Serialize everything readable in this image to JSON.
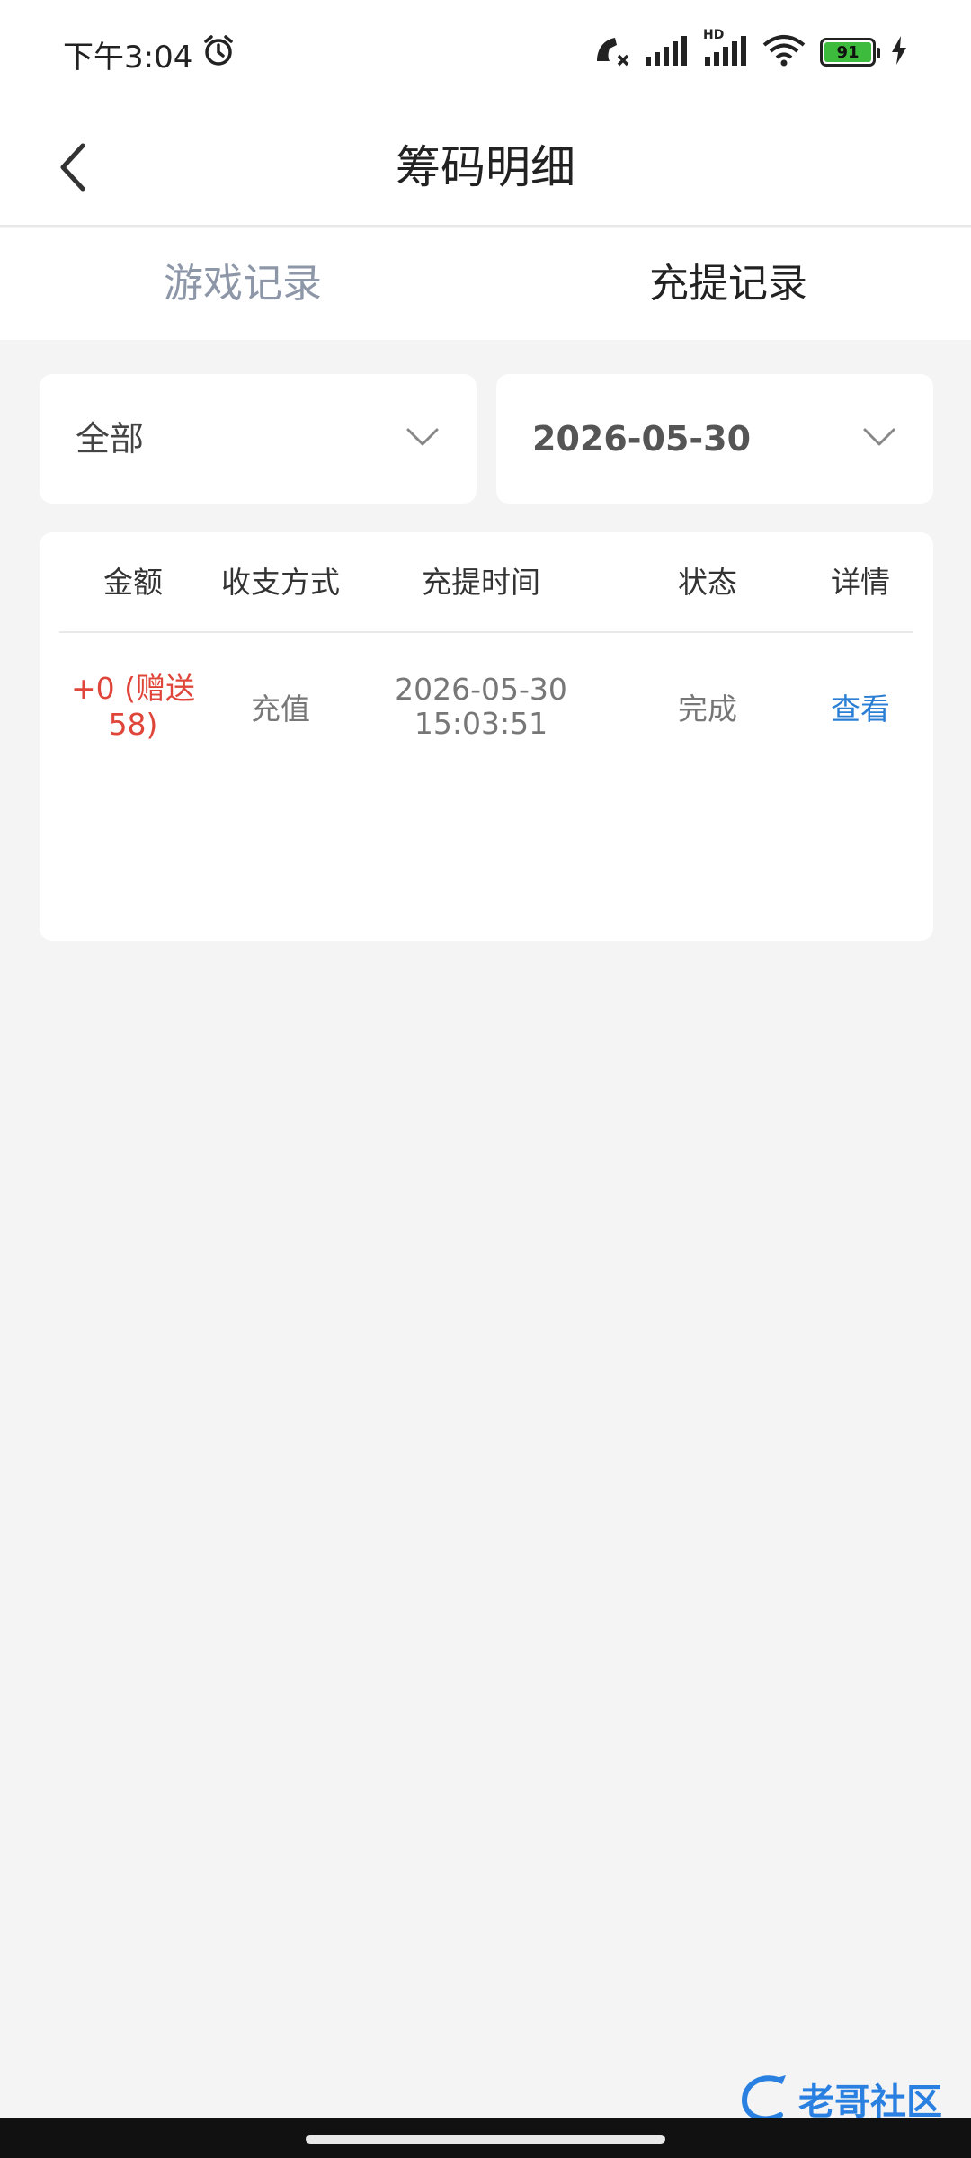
{
  "status_bar": {
    "time": "下午3:04",
    "battery": "91",
    "network_label": "HD"
  },
  "nav": {
    "title": "筹码明细"
  },
  "tabs": [
    {
      "label": "游戏记录",
      "active": false
    },
    {
      "label": "充提记录",
      "active": true
    }
  ],
  "filters": {
    "type_value": "全部",
    "date_value": "2026-05-30"
  },
  "table": {
    "headers": [
      "金额",
      "收支方式",
      "充提时间",
      "状态",
      "详情"
    ],
    "rows": [
      {
        "amount": "+0 (赠送58)",
        "method": "充值",
        "date": "2026-05-30",
        "time": "15:03:51",
        "status": "完成",
        "action": "查看"
      }
    ]
  },
  "watermark": {
    "text": "老哥社区"
  },
  "colors": {
    "accent_red": "#e0453a",
    "link_blue": "#2a7fd4",
    "tab_inactive": "#8d97a8",
    "background": "#f4f4f4"
  }
}
